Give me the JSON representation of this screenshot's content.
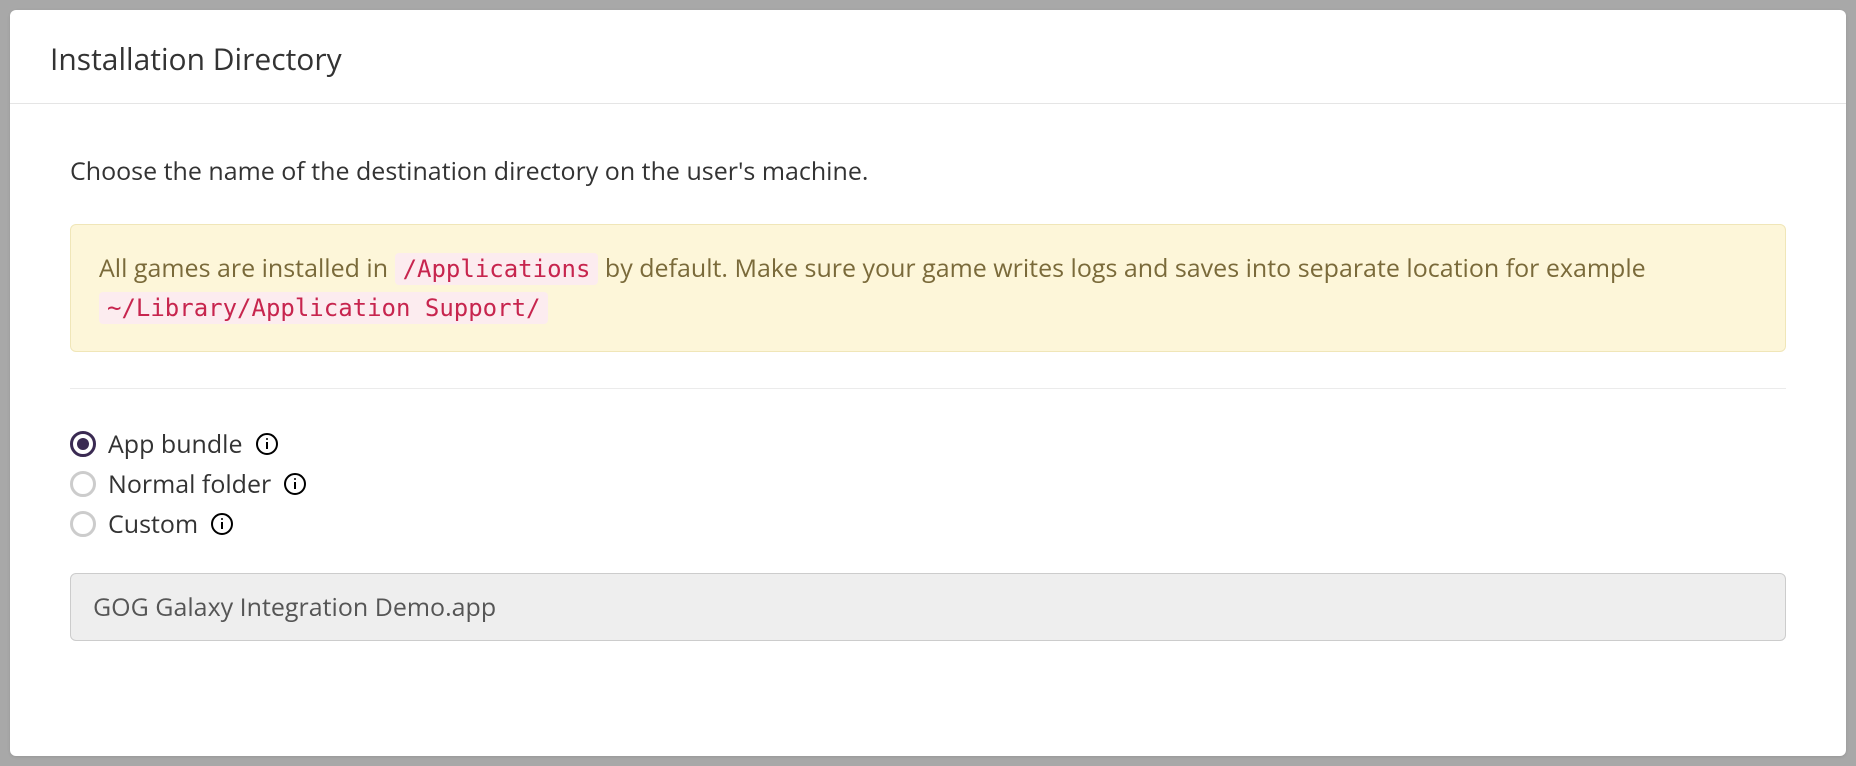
{
  "header": {
    "title": "Installation Directory"
  },
  "description": "Choose the name of the destination directory on the user's machine.",
  "alert": {
    "text_before_code1": "All games are installed in ",
    "code1": "/Applications",
    "text_between": " by default. Make sure your game writes logs and saves into separate location for example ",
    "code2": "~/Library/Application Support/"
  },
  "radios": {
    "options": [
      {
        "label": "App bundle",
        "selected": true
      },
      {
        "label": "Normal folder",
        "selected": false
      },
      {
        "label": "Custom",
        "selected": false
      }
    ]
  },
  "input": {
    "value": "GOG Galaxy Integration Demo.app"
  }
}
